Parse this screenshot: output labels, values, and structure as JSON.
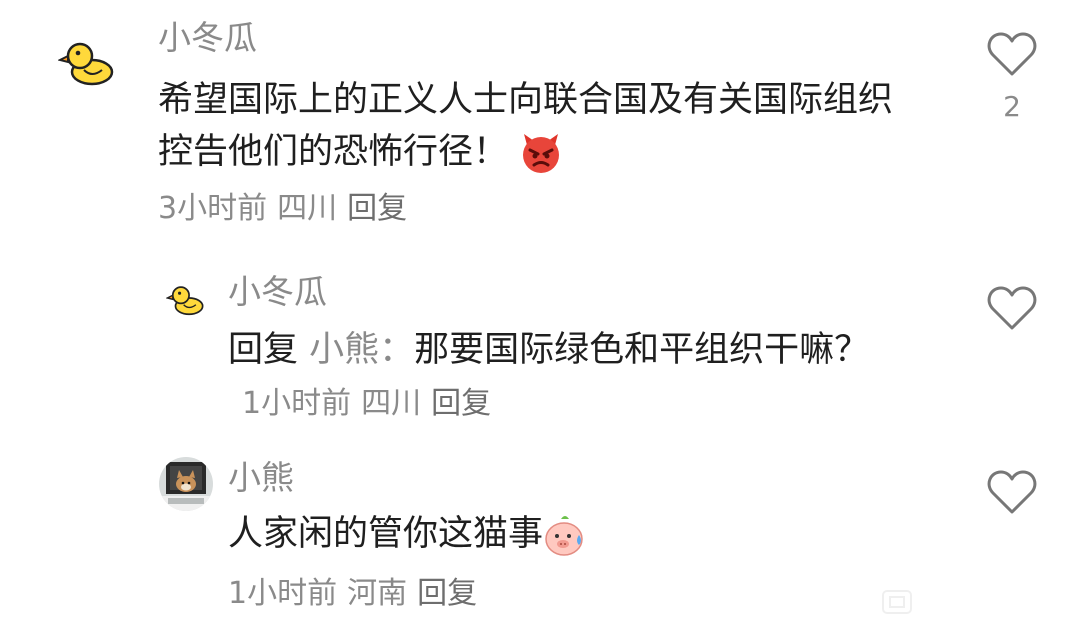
{
  "comments": [
    {
      "username": "小冬瓜",
      "text": "希望国际上的正义人士向联合国及有关国际组织控告他们的恐怖行径！",
      "emoji": "angry-devil-emoji",
      "time": "3小时前",
      "location": "四川",
      "reply_label": "回复",
      "like_count": "2",
      "avatar": "yellow-duck-avatar"
    },
    {
      "username": "小冬瓜",
      "reply_prefix": "回复",
      "reply_target": "小熊：",
      "text": "那要国际绿色和平组织干嘛？",
      "time": "1小时前",
      "location": "四川",
      "reply_label": "回复",
      "avatar": "yellow-duck-avatar"
    },
    {
      "username": "小熊",
      "text": "人家闲的管你这猫事",
      "emoji": "sweating-pig-emoji",
      "time": "1小时前",
      "location": "河南",
      "reply_label": "回复",
      "avatar": "dog-photo-avatar"
    }
  ],
  "icons": {
    "like": "heart-outline-icon"
  },
  "colors": {
    "text": "#1f1f1f",
    "secondary": "#8a8a8a",
    "duck": "#ffd93b"
  }
}
